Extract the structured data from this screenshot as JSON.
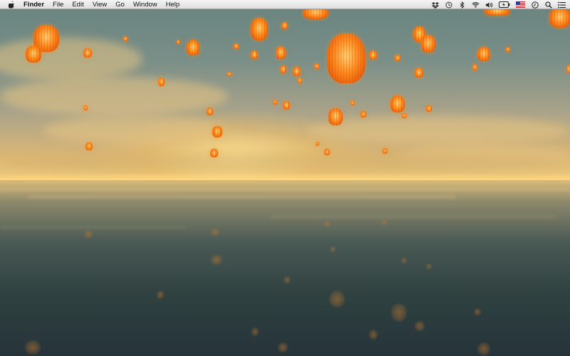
{
  "menubar": {
    "apple_icon": "apple-logo-icon",
    "app_name": "Finder",
    "menus": [
      "File",
      "Edit",
      "View",
      "Go",
      "Window",
      "Help"
    ],
    "status_icons": [
      "dropbox-icon",
      "time-machine-icon",
      "bluetooth-icon",
      "wifi-icon",
      "volume-icon",
      "battery-icon",
      "us-flag-input-icon",
      "clock-icon",
      "spotlight-search-icon",
      "notification-center-icon"
    ]
  },
  "desktop": {
    "wallpaper": "floating-lanterns-over-water",
    "colors": {
      "lantern_core": "#ffd070",
      "lantern_body": "#ff8a1c",
      "sky_top": "#6b8580",
      "sun_glow": "#f0c978",
      "water_dark": "#26343a"
    }
  }
}
